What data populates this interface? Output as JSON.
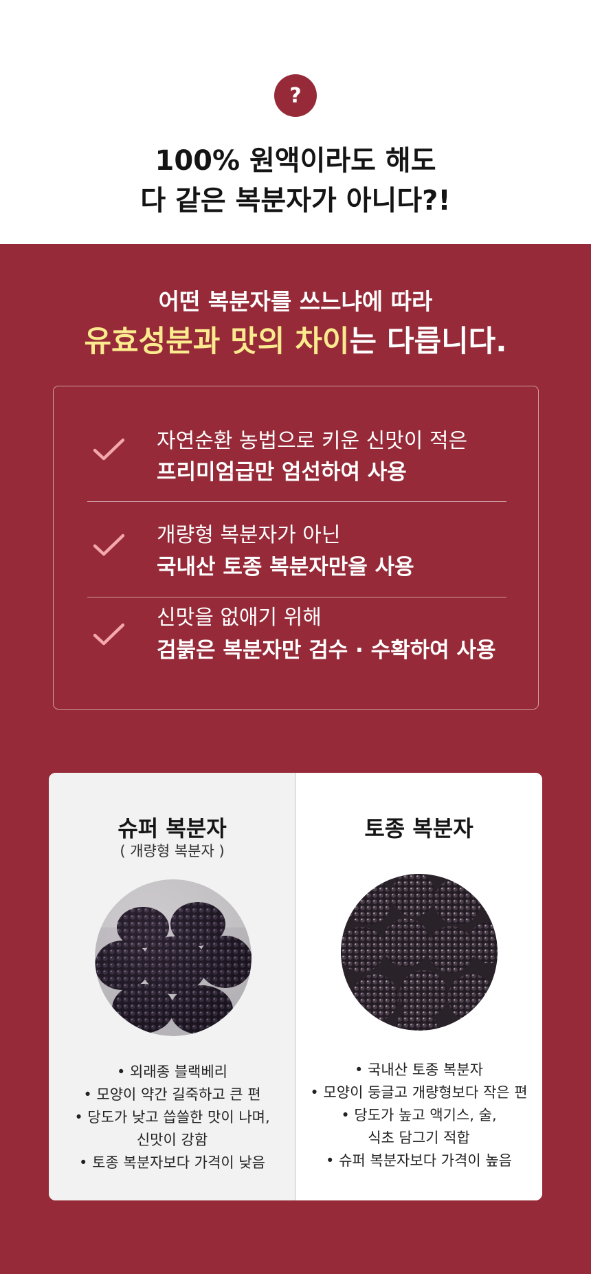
{
  "header": {
    "question_mark": "?",
    "headline_line1": "100% 원액이라도 해도",
    "headline_line2": "다 같은 복분자가 아니다?!"
  },
  "intro": {
    "line1": "어떤 복분자를 쓰느냐에 따라",
    "line2_highlight": "유효성분과 맛의 차이",
    "line2_rest": "는 다릅니다."
  },
  "features": [
    {
      "line1": "자연순환 농법으로 키운 신맛이 적은",
      "line2": "프리미엄급만 엄선하여 사용"
    },
    {
      "line1": "개량형 복분자가 아닌",
      "line2": "국내산 토종 복분자만을 사용"
    },
    {
      "line1": "신맛을 없애기 위해",
      "line2": "검붉은 복분자만 검수 · 수확하여 사용"
    }
  ],
  "comparison": {
    "left": {
      "title": "슈퍼 복분자",
      "subtitle": "( 개량형 복분자 )",
      "bullets": [
        "• 외래종 블랙베리",
        "• 모양이 약간 길죽하고 큰 편",
        "• 당도가 낮고 씁쓸한 맛이 나며,",
        "신맛이 강함",
        "• 토종 복분자보다 가격이 낮음"
      ]
    },
    "right": {
      "title": "토종 복분자",
      "bullets": [
        "• 국내산 토종 복분자",
        "• 모양이 둥글고 개량형보다 작은 편",
        "• 당도가 높고 액기스, 술,",
        "식초 담그기 적합",
        "• 슈퍼 복분자보다 가격이 높음"
      ]
    }
  },
  "colors": {
    "maroon": "#962a38",
    "highlight_yellow": "#fbeb8e",
    "check_pink": "#f4a7ad"
  }
}
